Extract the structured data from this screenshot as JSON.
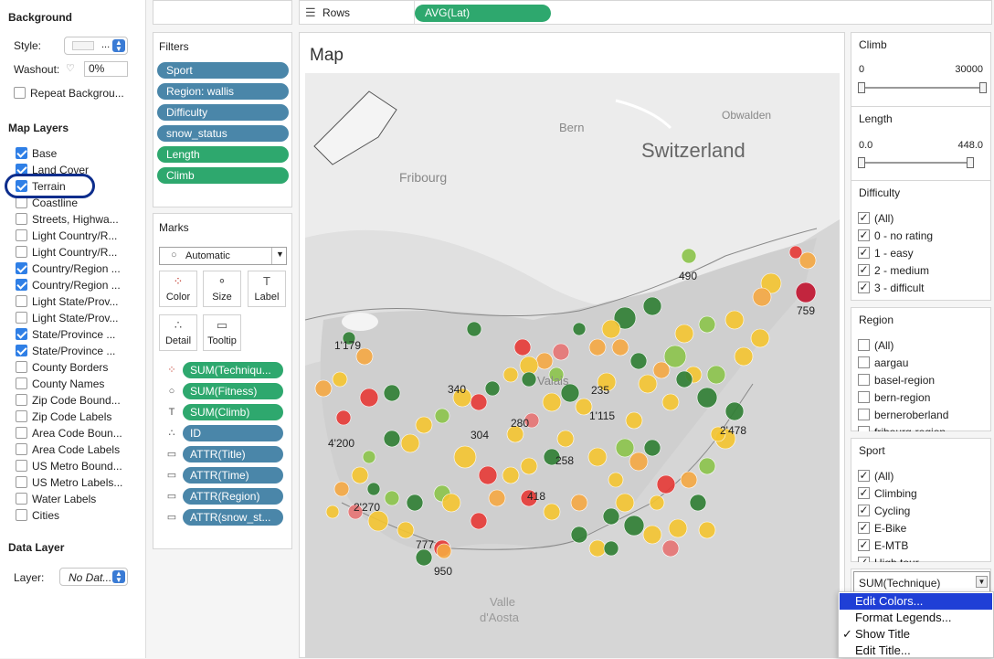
{
  "background": {
    "title": "Background",
    "style_label": "Style:",
    "style_value": "...",
    "washout_label": "Washout:",
    "washout_value": "0%",
    "repeat_label": "Repeat Backgrou..."
  },
  "map_layers": {
    "title": "Map Layers",
    "items": [
      {
        "label": "Base",
        "checked": true
      },
      {
        "label": "Land Cover",
        "checked": true
      },
      {
        "label": "Terrain",
        "checked": true
      },
      {
        "label": "Coastline",
        "checked": false
      },
      {
        "label": "Streets, Highwa...",
        "checked": false
      },
      {
        "label": "Light Country/R...",
        "checked": false
      },
      {
        "label": "Light Country/R...",
        "checked": false
      },
      {
        "label": "Country/Region ...",
        "checked": true
      },
      {
        "label": "Country/Region ...",
        "checked": true
      },
      {
        "label": "Light State/Prov...",
        "checked": false
      },
      {
        "label": "Light State/Prov...",
        "checked": false
      },
      {
        "label": "State/Province ...",
        "checked": true
      },
      {
        "label": "State/Province ...",
        "checked": true
      },
      {
        "label": "County Borders",
        "checked": false
      },
      {
        "label": "County Names",
        "checked": false
      },
      {
        "label": "Zip Code Bound...",
        "checked": false
      },
      {
        "label": "Zip Code Labels",
        "checked": false
      },
      {
        "label": "Area Code Boun...",
        "checked": false
      },
      {
        "label": "Area Code Labels",
        "checked": false
      },
      {
        "label": "US Metro Bound...",
        "checked": false
      },
      {
        "label": "US Metro Labels...",
        "checked": false
      },
      {
        "label": "Water Labels",
        "checked": false
      },
      {
        "label": "Cities",
        "checked": false
      }
    ]
  },
  "data_layer": {
    "title": "Data Layer",
    "layer_label": "Layer:",
    "layer_value": "No Dat..."
  },
  "rows_shelf": {
    "label": "Rows",
    "pill": "AVG(Lat)"
  },
  "filters": {
    "title": "Filters",
    "items": [
      {
        "label": "Sport",
        "color": "blue"
      },
      {
        "label": "Region: wallis",
        "color": "blue"
      },
      {
        "label": "Difficulty",
        "color": "blue"
      },
      {
        "label": "snow_status",
        "color": "blue"
      },
      {
        "label": "Length",
        "color": "green"
      },
      {
        "label": "Climb",
        "color": "green"
      }
    ]
  },
  "marks": {
    "title": "Marks",
    "type": "Automatic",
    "buttons": [
      "Color",
      "Size",
      "Label",
      "Detail",
      "Tooltip"
    ],
    "fields": [
      {
        "icon": "color-icon",
        "label": "SUM(Techniqu...",
        "color": "green"
      },
      {
        "icon": "size-icon",
        "label": "SUM(Fitness)",
        "color": "green"
      },
      {
        "icon": "label-icon",
        "label": "SUM(Climb)",
        "color": "green"
      },
      {
        "icon": "detail-icon",
        "label": "ID",
        "color": "blue"
      },
      {
        "icon": "tooltip-icon",
        "label": "ATTR(Title)",
        "color": "blue"
      },
      {
        "icon": "tooltip-icon",
        "label": "ATTR(Time)",
        "color": "blue"
      },
      {
        "icon": "tooltip-icon",
        "label": "ATTR(Region)",
        "color": "blue"
      },
      {
        "icon": "tooltip-icon",
        "label": "ATTR(snow_st...",
        "color": "blue"
      }
    ]
  },
  "map": {
    "title": "Map",
    "place_labels": [
      "Bern",
      "Obwalden",
      "Switzerland",
      "Fribourg",
      "Valais",
      "Valle",
      "d'Aosta"
    ],
    "value_labels": [
      "490",
      "759",
      "1'179",
      "340",
      "235",
      "1'115",
      "280",
      "304",
      "4'200",
      "2'478",
      "258",
      "418",
      "2'270",
      "777",
      "950"
    ]
  },
  "climb": {
    "title": "Climb",
    "min": "0",
    "max": "30000"
  },
  "length": {
    "title": "Length",
    "min": "0.0",
    "max": "448.0"
  },
  "difficulty": {
    "title": "Difficulty",
    "items": [
      "(All)",
      "0 - no rating",
      "1 - easy",
      "2 - medium",
      "3 - difficult"
    ]
  },
  "region": {
    "title": "Region",
    "items": [
      "(All)",
      "aargau",
      "basel-region",
      "bern-region",
      "berneroberland",
      "fribourg-region"
    ]
  },
  "sport": {
    "title": "Sport",
    "items": [
      "(All)",
      "Climbing",
      "Cycling",
      "E-Bike",
      "E-MTB",
      "High tour"
    ]
  },
  "legend": {
    "title": "SUM(Technique)"
  },
  "context_menu": {
    "items": [
      "Edit Colors...",
      "Format Legends...",
      "Show Title",
      "Edit Title..."
    ],
    "check": "✓"
  },
  "colors": {
    "blue_pill": "#4a86a9",
    "green_pill": "#2ea86e",
    "highlight": "#1f3fd6",
    "annotation_ring": "#0d2d8c"
  }
}
